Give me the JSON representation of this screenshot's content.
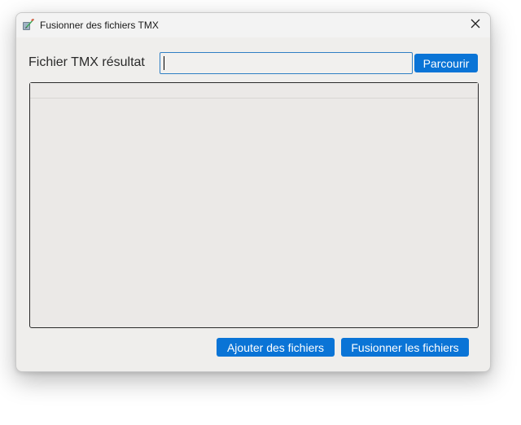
{
  "window": {
    "title": "Fusionner des fichiers TMX",
    "app_icon": "app-quill-icon",
    "close_icon": "close-icon"
  },
  "output": {
    "label": "Fichier TMX résultat",
    "value": "",
    "browse_label": "Parcourir"
  },
  "file_list": {
    "items": []
  },
  "actions": {
    "add_label": "Ajouter des fichiers",
    "merge_label": "Fusionner les fichiers"
  },
  "colors": {
    "accent": "#0a74d6",
    "window_bg": "#efeeec",
    "input_border": "#2f7fc4"
  }
}
